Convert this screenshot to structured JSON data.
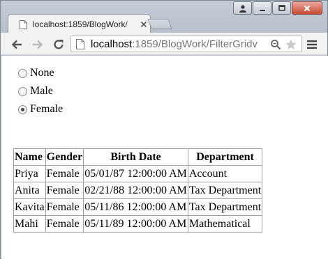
{
  "browser": {
    "tab_title": "localhost:1859/BlogWork/",
    "url_host": "localhost",
    "url_rest": ":1859/BlogWork/FilterGridv"
  },
  "filter": {
    "options": [
      {
        "label": "None",
        "checked": false
      },
      {
        "label": "Male",
        "checked": false
      },
      {
        "label": "Female",
        "checked": true
      }
    ]
  },
  "grid": {
    "columns": [
      "Name",
      "Gender",
      "Birth Date",
      "Department"
    ],
    "rows": [
      [
        "Priya",
        "Female",
        "05/01/87 12:00:00 AM",
        "Account"
      ],
      [
        "Anita",
        "Female",
        "02/21/88 12:00:00 AM",
        "Tax Department"
      ],
      [
        "Kavita",
        "Female",
        "05/11/86 12:00:00 AM",
        "Tax Department"
      ],
      [
        "Mahi",
        "Female",
        "05/11/89 12:00:00 AM",
        "Mathematical"
      ]
    ]
  },
  "icons": {
    "back": "back-arrow-icon",
    "forward": "forward-arrow-icon",
    "reload": "reload-icon",
    "page": "page-icon",
    "zoom": "zoom-icon",
    "star": "star-icon",
    "menu": "menu-icon"
  }
}
